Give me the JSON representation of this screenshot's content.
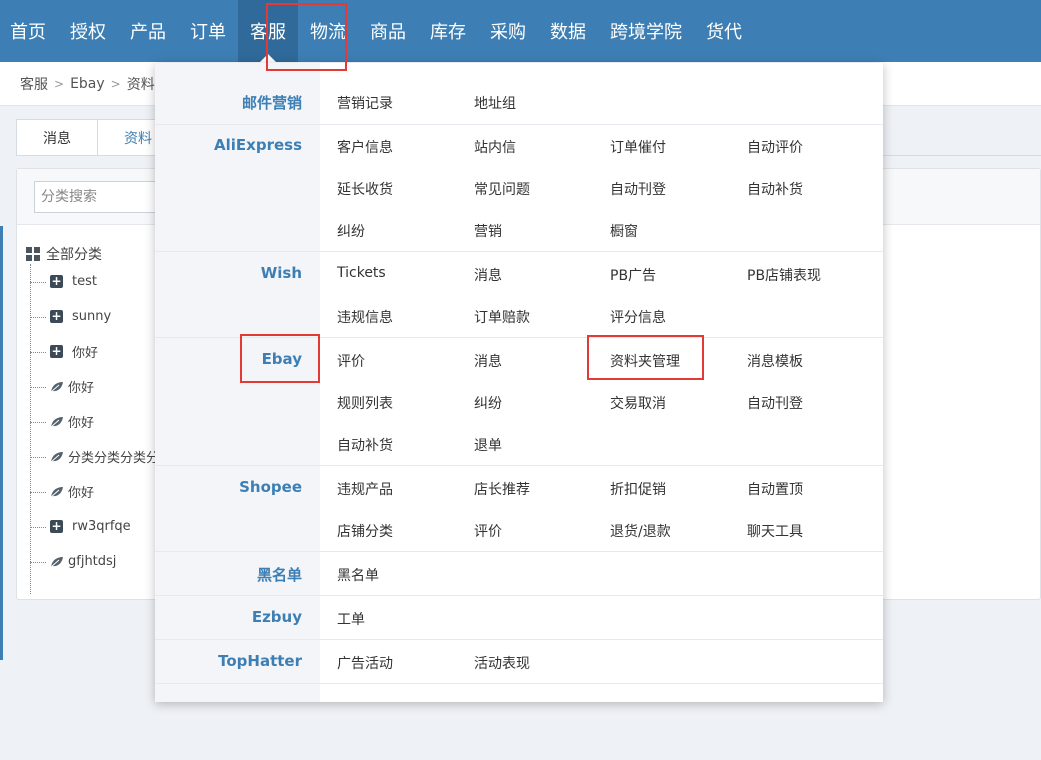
{
  "nav": {
    "items": [
      "首页",
      "授权",
      "产品",
      "订单",
      "客服",
      "物流",
      "商品",
      "库存",
      "采购",
      "数据",
      "跨境学院",
      "货代"
    ],
    "active_index": 4
  },
  "breadcrumb": [
    "客服",
    "Ebay",
    "资料夹"
  ],
  "tabs": [
    "消息",
    "资料"
  ],
  "search": {
    "placeholder": "分类搜索"
  },
  "tree": {
    "root": "全部分类",
    "items": [
      {
        "label": "test",
        "icon": "plus-icon"
      },
      {
        "label": "sunny",
        "icon": "plus-icon"
      },
      {
        "label": "你好",
        "icon": "plus-icon"
      },
      {
        "label": "你好",
        "icon": "leaf-icon"
      },
      {
        "label": "你好",
        "icon": "leaf-icon"
      },
      {
        "label": "分类分类分类分",
        "icon": "leaf-icon"
      },
      {
        "label": "你好",
        "icon": "leaf-icon"
      },
      {
        "label": "rw3qrfqe",
        "icon": "plus-icon"
      },
      {
        "label": "gfjhtdsj",
        "icon": "leaf-icon"
      }
    ]
  },
  "dropdown": {
    "sections": [
      {
        "category": "邮件营销",
        "rows": [
          [
            "营销记录",
            "地址组"
          ]
        ]
      },
      {
        "category": "AliExpress",
        "rows": [
          [
            "客户信息",
            "站内信",
            "订单催付",
            "自动评价"
          ],
          [
            "延长收货",
            "常见问题",
            "自动刊登",
            "自动补货"
          ],
          [
            "纠纷",
            "营销",
            "橱窗"
          ]
        ]
      },
      {
        "category": "Wish",
        "rows": [
          [
            "Tickets",
            "消息",
            "PB广告",
            "PB店铺表现"
          ],
          [
            "违规信息",
            "订单赔款",
            "评分信息"
          ]
        ]
      },
      {
        "category": "Ebay",
        "rows": [
          [
            "评价",
            "消息",
            "资料夹管理",
            "消息模板"
          ],
          [
            "规则列表",
            "纠纷",
            "交易取消",
            "自动刊登"
          ],
          [
            "自动补货",
            "退单"
          ]
        ]
      },
      {
        "category": "Shopee",
        "rows": [
          [
            "违规产品",
            "店长推荐",
            "折扣促销",
            "自动置顶"
          ],
          [
            "店铺分类",
            "评价",
            "退货/退款",
            "聊天工具"
          ]
        ]
      },
      {
        "category": "黑名单",
        "rows": [
          [
            "黑名单"
          ]
        ]
      },
      {
        "category": "Ezbuy",
        "rows": [
          [
            "工单"
          ]
        ]
      },
      {
        "category": "TopHatter",
        "rows": [
          [
            "广告活动",
            "活动表现"
          ]
        ]
      }
    ]
  },
  "colors": {
    "nav_bg": "#3d7fb4",
    "accent": "#3d7fb4",
    "highlight_box": "#e53935"
  }
}
